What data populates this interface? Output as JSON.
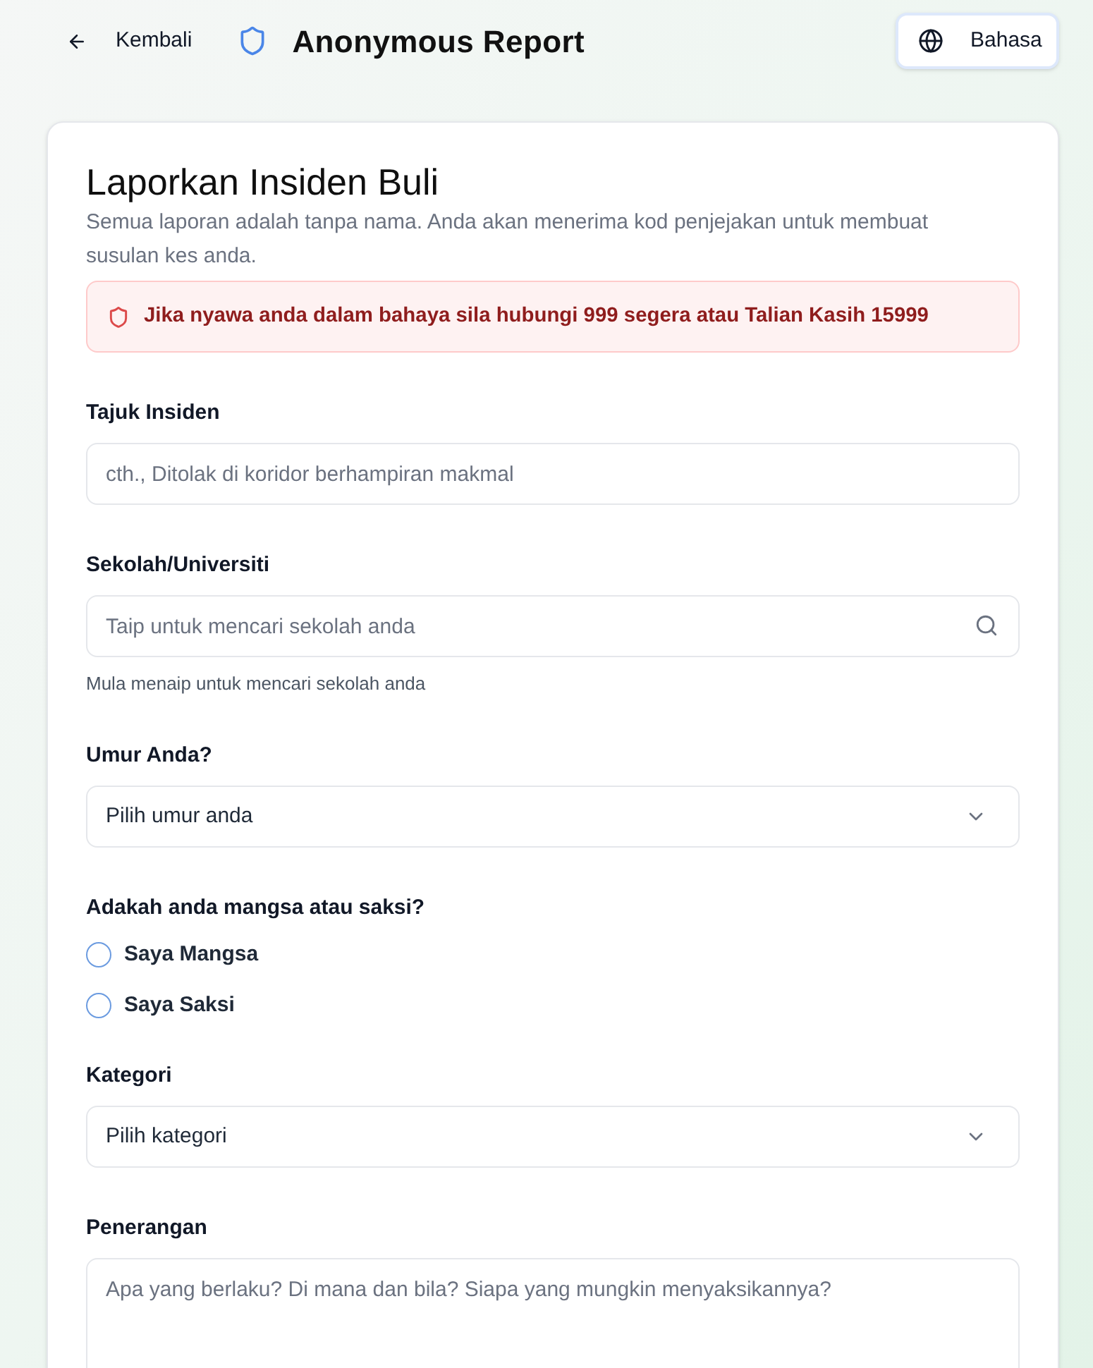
{
  "header": {
    "back_link": "Kembali",
    "title": "Anonymous Report",
    "language_button": "Bahasa"
  },
  "form": {
    "title": "Laporkan Insiden Buli",
    "subtitle": "Semua laporan adalah tanpa nama. Anda akan menerima kod penjejakan untuk membuat susulan kes anda.",
    "alert": "Jika nyawa anda dalam bahaya sila hubungi 999 segera atau Talian Kasih 15999",
    "fields": [
      {
        "kind": "text",
        "label": "Tajuk Insiden",
        "placeholder": "cth., Ditolak di koridor berhampiran makmal"
      },
      {
        "kind": "search",
        "label": "Sekolah/Universiti",
        "placeholder": "Taip untuk mencari sekolah anda",
        "hint": "Mula menaip untuk mencari sekolah anda"
      },
      {
        "kind": "select",
        "label": "Umur Anda?",
        "value": "Pilih umur anda"
      },
      {
        "kind": "radio",
        "label": "Adakah anda mangsa atau saksi?",
        "options": [
          {
            "label": "Saya Mangsa",
            "selected": false
          },
          {
            "label": "Saya Saksi",
            "selected": false
          }
        ]
      },
      {
        "kind": "select",
        "label": "Kategori",
        "value": "Pilih kategori"
      },
      {
        "kind": "textarea",
        "label": "Penerangan",
        "placeholder": "Apa yang berlaku? Di mana dan bila? Siapa yang mungkin menyaksikannya?"
      }
    ]
  }
}
